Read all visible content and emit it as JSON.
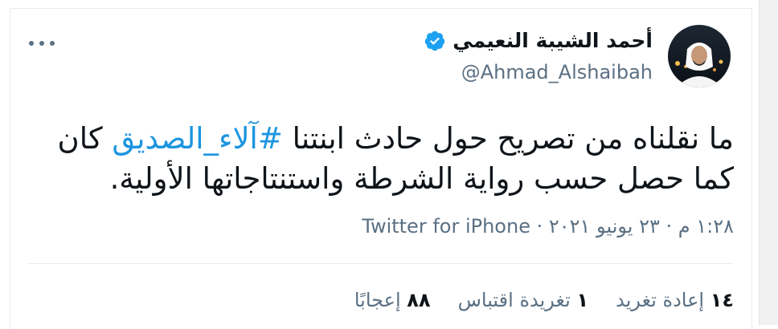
{
  "tweet": {
    "author": {
      "name": "أحمد الشيبة النعيمي",
      "handle": "@Ahmad_Alshaibah",
      "verified": true
    },
    "text_before": "ما نقلناه من تصريح حول حادث ابنتنا ",
    "hashtag": "#آلاء_الصديق",
    "text_after": " كان كما حصل حسب رواية الشرطة واستنتاجاتها الأولية.",
    "timestamp": "١:٢٨ م · ٢٣ يونيو ٢٠٢١",
    "separator": " · ",
    "source": "Twitter for iPhone",
    "stats": [
      {
        "value": "١٤",
        "label": "إعادة تغريد"
      },
      {
        "value": "١",
        "label": "تغريدة اقتباس"
      },
      {
        "value": "٨٨",
        "label": "إعجابًا"
      }
    ]
  },
  "colors": {
    "accent": "#1b95e0",
    "secondary_text": "#5b7083",
    "divider": "#e6ecf0"
  },
  "icons": {
    "verified": "verified-badge-icon",
    "more": "more-options-icon"
  }
}
